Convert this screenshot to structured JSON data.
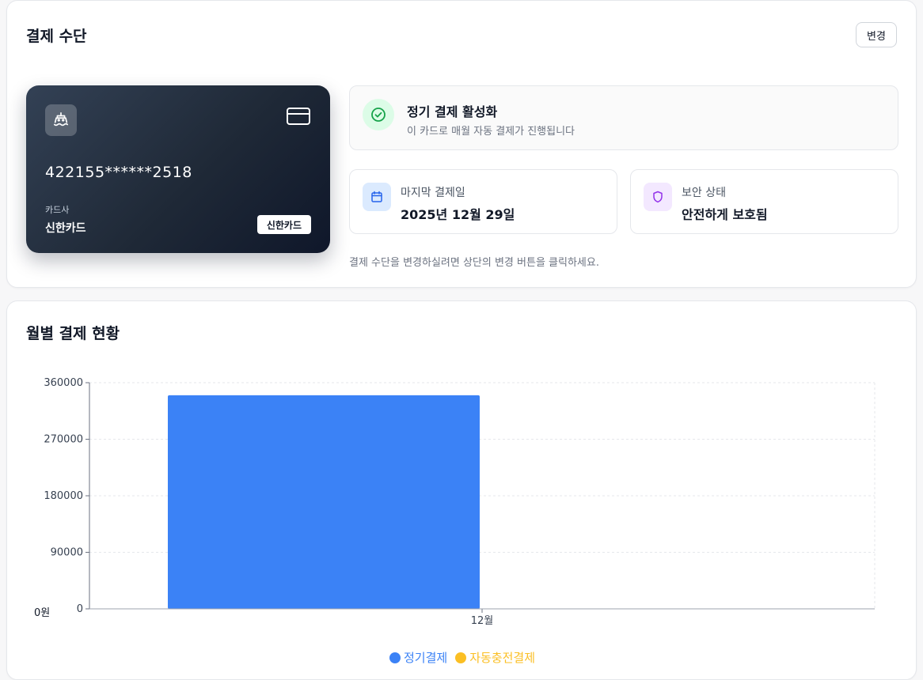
{
  "payment": {
    "title": "결제 수단",
    "change_label": "변경",
    "card": {
      "logo_icon": "ship-icon",
      "type_icon": "credit-card-icon",
      "number": "422155******2518",
      "issuer_label": "카드사",
      "issuer": "신한카드",
      "chip": "신한카드"
    },
    "recurring": {
      "icon": "check-circle-icon",
      "title": "정기 결제 활성화",
      "subtitle": "이 카드로 매월 자동 결제가 진행됩니다"
    },
    "last_payment": {
      "icon": "calendar-icon",
      "label": "마지막 결제일",
      "value": "2025년 12월 29일"
    },
    "security": {
      "icon": "shield-icon",
      "label": "보안 상태",
      "value": "안전하게 보호됨"
    },
    "hint": "결제 수단을 변경하실려면 상단의 변경 버튼을 클릭하세요."
  },
  "monthly": {
    "title": "월별 결제 현황"
  },
  "chart_data": {
    "type": "bar",
    "title": "월별 결제 현황",
    "categories": [
      "12월"
    ],
    "series": [
      {
        "name": "정기결제",
        "values": [
          340000
        ],
        "color": "#3b82f6"
      },
      {
        "name": "자동충전결제",
        "values": [
          0
        ],
        "color": "#fbbf24"
      }
    ],
    "yticks": [
      "0",
      "90000",
      "180000",
      "270000",
      "360000"
    ],
    "y_zero_label": "0원",
    "ylim": [
      0,
      360000
    ],
    "grid": true,
    "legend_position": "bottom"
  }
}
